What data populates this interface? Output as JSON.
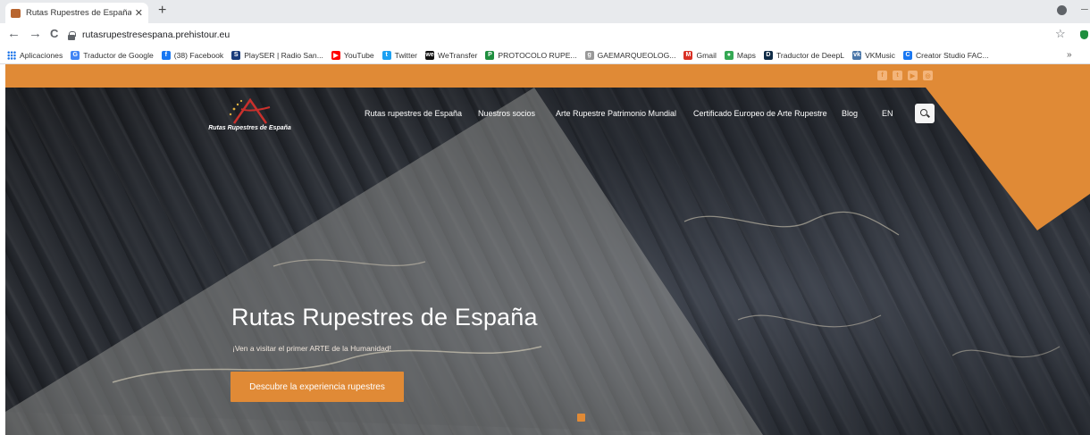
{
  "browser": {
    "tab_title": "Rutas Rupestres de España – Ruta",
    "tab_close": "✕",
    "new_tab": "+",
    "back": "←",
    "forward": "→",
    "reload": "C",
    "url": "rutasrupestresespana.prehistour.eu",
    "star": "☆",
    "minimize": "–",
    "more_bookmarks": "»",
    "bookmarks": [
      {
        "label": "Aplicaciones",
        "icon": "apps-grid-icon"
      },
      {
        "label": "Traductor de Google",
        "icon": "google-translate-icon",
        "color": "#4285f4",
        "glyph": "G"
      },
      {
        "label": "(38) Facebook",
        "icon": "facebook-icon",
        "color": "#1877f2",
        "glyph": "f"
      },
      {
        "label": "PlaySER | Radio San...",
        "icon": "playser-icon",
        "color": "#1a3c7a",
        "glyph": "S"
      },
      {
        "label": "YouTube",
        "icon": "youtube-icon",
        "color": "#ff0000",
        "glyph": "▶"
      },
      {
        "label": "Twitter",
        "icon": "twitter-icon",
        "color": "#1da1f2",
        "glyph": "t"
      },
      {
        "label": "WeTransfer",
        "icon": "wetransfer-icon",
        "color": "#111111",
        "glyph": "we"
      },
      {
        "label": "PROTOCOLO RUPE...",
        "icon": "protocolo-icon",
        "color": "#1e8e3e",
        "glyph": "P"
      },
      {
        "label": "GAEMARQUEOLOG...",
        "icon": "gaem-icon",
        "color": "#999999",
        "glyph": "g"
      },
      {
        "label": "Gmail",
        "icon": "gmail-icon",
        "color": "#d93025",
        "glyph": "M"
      },
      {
        "label": "Maps",
        "icon": "maps-pin-icon",
        "color": "#34a853",
        "glyph": "●"
      },
      {
        "label": "Traductor de DeepL",
        "icon": "deepl-icon",
        "color": "#0f2b46",
        "glyph": "D"
      },
      {
        "label": "VKMusic",
        "icon": "vk-icon",
        "color": "#4a76a8",
        "glyph": "vk"
      },
      {
        "label": "Creator Studio FAC...",
        "icon": "creator-studio-icon",
        "color": "#1877f2",
        "glyph": "C"
      }
    ]
  },
  "site": {
    "accent": "#e08a36",
    "social": [
      {
        "name": "facebook",
        "glyph": "f"
      },
      {
        "name": "twitter",
        "glyph": "t"
      },
      {
        "name": "youtube",
        "glyph": "▶"
      },
      {
        "name": "instagram",
        "glyph": "◎"
      }
    ],
    "logo_text": "Rutas Rupestres de España",
    "nav": [
      {
        "label": "Rutas rupestres de España"
      },
      {
        "label": "Nuestros socios"
      },
      {
        "label": "Arte Rupestre Patrimonio Mundial"
      },
      {
        "label": "Certificado Europeo de Arte Rupestre"
      },
      {
        "label": "Blog"
      },
      {
        "label": "EN"
      }
    ],
    "hero": {
      "title": "Rutas Rupestres de España",
      "subtitle": "¡Ven a visitar el primer ARTE de la Humanidad!",
      "cta": "Descubre la experiencia rupestres"
    }
  }
}
